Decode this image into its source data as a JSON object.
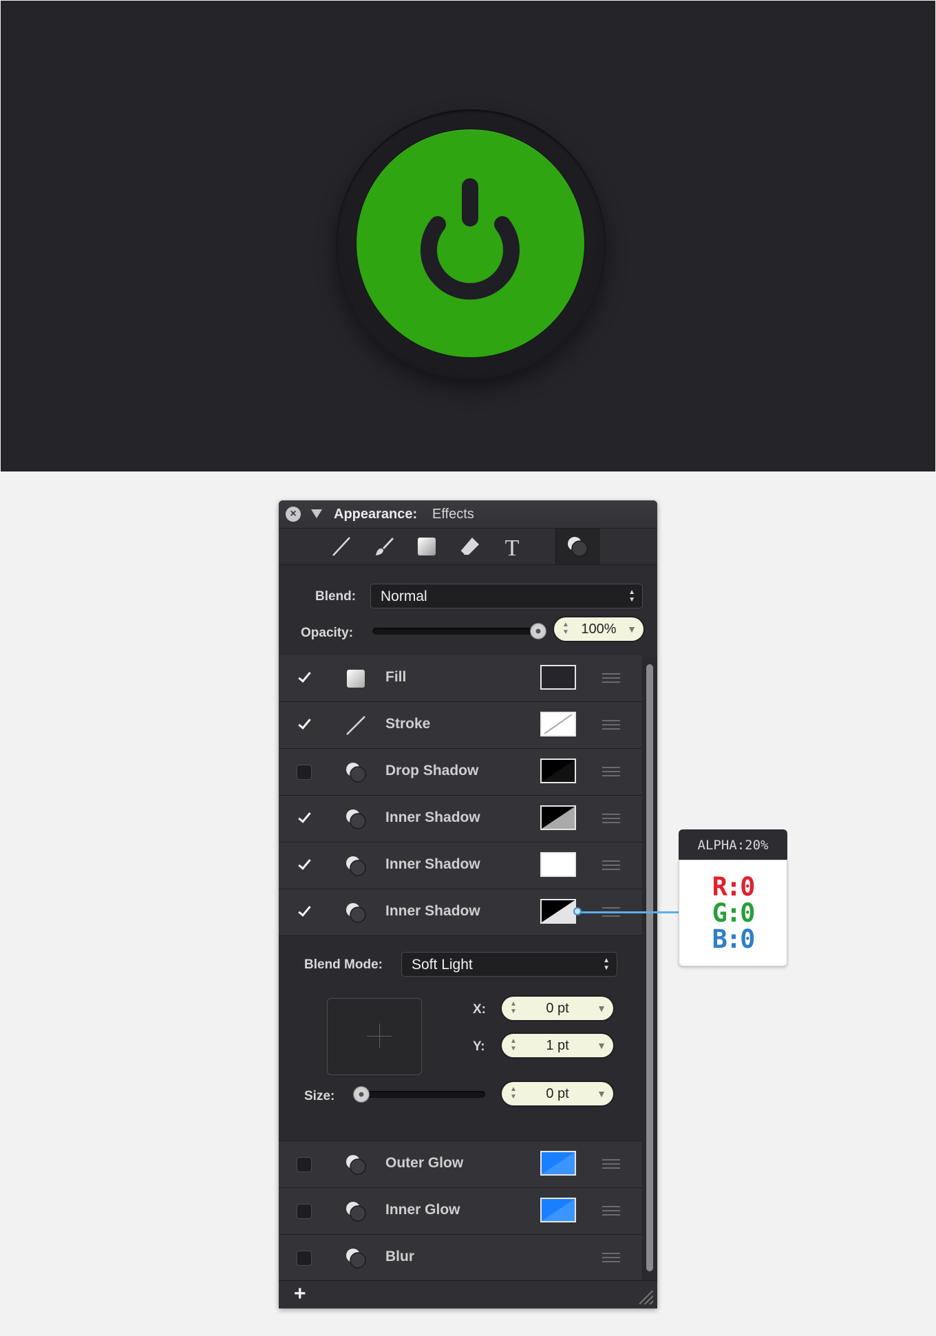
{
  "colors": {
    "artboard_bg": "#252429",
    "power_green": "#2ea511",
    "panel_bg": "#2d2d31",
    "field_bg": "#f3f4de",
    "glow_blue": "#1a7fff",
    "rgb_red": "#e0212e",
    "rgb_green": "#2a9e3a",
    "rgb_blue": "#2f7ec8"
  },
  "artwork": {
    "icon": "power-icon"
  },
  "panel": {
    "title_label": "Appearance:",
    "title_sub": "Effects",
    "toolbar_icons": [
      "line-tool-icon",
      "brush-tool-icon",
      "square-fill-icon",
      "eraser-tool-icon",
      "text-tool-icon",
      "effects-icon"
    ],
    "blend_label": "Blend:",
    "blend_value": "Normal",
    "opacity_label": "Opacity:",
    "opacity_value": "100%",
    "opacity_level": 1.0,
    "effects_top": [
      {
        "name": "Fill",
        "checked": true,
        "icon": "fill-icon"
      },
      {
        "name": "Stroke",
        "checked": true,
        "icon": "stroke-icon"
      },
      {
        "name": "Drop Shadow",
        "checked": false,
        "icon": "effect-circles-icon"
      },
      {
        "name": "Inner Shadow",
        "checked": true,
        "icon": "effect-circles-icon"
      },
      {
        "name": "Inner Shadow",
        "checked": true,
        "icon": "effect-circles-icon"
      },
      {
        "name": "Inner Shadow",
        "checked": true,
        "icon": "effect-circles-icon"
      }
    ],
    "details": {
      "blend_mode_label": "Blend Mode:",
      "blend_mode_value": "Soft Light",
      "x_label": "X:",
      "x_value": "0 pt",
      "y_label": "Y:",
      "y_value": "1 pt",
      "size_label": "Size:",
      "size_value": "0 pt",
      "size_level": 0
    },
    "effects_bottom": [
      {
        "name": "Outer Glow",
        "checked": false,
        "icon": "effect-circles-icon"
      },
      {
        "name": "Inner Glow",
        "checked": false,
        "icon": "effect-circles-icon"
      },
      {
        "name": "Blur",
        "checked": false,
        "icon": "effect-circles-icon"
      }
    ],
    "add_label": "+"
  },
  "callout": {
    "header": "ALPHA:20%",
    "r": "R:0",
    "g": "G:0",
    "b": "B:0"
  }
}
